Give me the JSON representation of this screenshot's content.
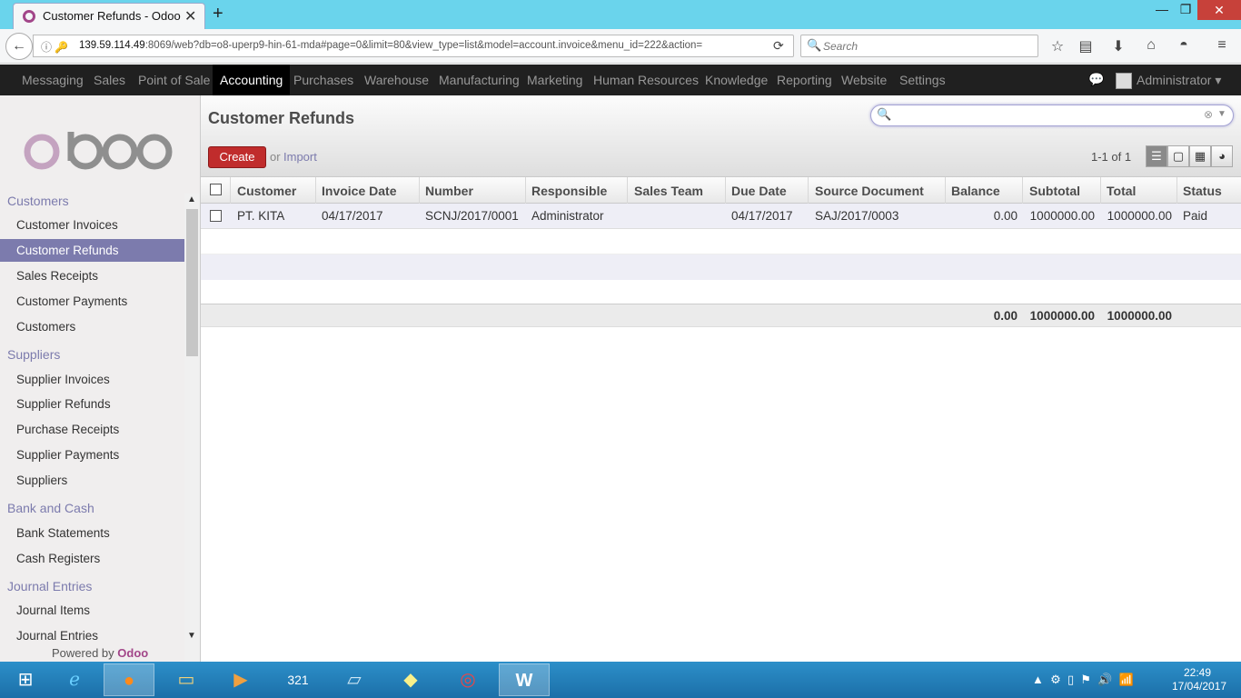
{
  "browser": {
    "tab_title": "Customer Refunds - Odoo",
    "url_host": "139.59.114.49",
    "url_rest": ":8069/web?db=o8-uperp9-hin-61-mda#page=0&limit=80&view_type=list&model=account.invoice&menu_id=222&action=",
    "search_placeholder": "Search",
    "new_tab": "+"
  },
  "menu": {
    "items": [
      "Messaging",
      "Sales",
      "Point of Sale",
      "Accounting",
      "Purchases",
      "Warehouse",
      "Manufacturing",
      "Marketing",
      "Human Resources",
      "Knowledge",
      "Reporting",
      "Website",
      "Settings"
    ],
    "active": "Accounting",
    "user": "Administrator"
  },
  "sidebar": {
    "logo": "odoo",
    "sections": [
      {
        "title": "Customers",
        "items": [
          "Customer Invoices",
          "Customer Refunds",
          "Sales Receipts",
          "Customer Payments",
          "Customers"
        ]
      },
      {
        "title": "Suppliers",
        "items": [
          "Supplier Invoices",
          "Supplier Refunds",
          "Purchase Receipts",
          "Supplier Payments",
          "Suppliers"
        ]
      },
      {
        "title": "Bank and Cash",
        "items": [
          "Bank Statements",
          "Cash Registers"
        ]
      },
      {
        "title": "Journal Entries",
        "items": [
          "Journal Items",
          "Journal Entries"
        ]
      }
    ],
    "active_item": "Customer Refunds",
    "powered_by": "Powered by",
    "powered_brand": "Odoo"
  },
  "main": {
    "title": "Customer Refunds",
    "create_label": "Create",
    "or_label": "or",
    "import_label": "Import",
    "pager": "1-1 of 1",
    "search_value": "",
    "columns": [
      "Customer",
      "Invoice Date",
      "Number",
      "Responsible",
      "Sales Team",
      "Due Date",
      "Source Document",
      "Balance",
      "Subtotal",
      "Total",
      "Status"
    ],
    "rows": [
      {
        "customer": "PT. KITA",
        "invoice_date": "04/17/2017",
        "number": "SCNJ/2017/0001",
        "responsible": "Administrator",
        "sales_team": "",
        "due_date": "04/17/2017",
        "source_document": "SAJ/2017/0003",
        "balance": "0.00",
        "subtotal": "1000000.00",
        "total": "1000000.00",
        "status": "Paid"
      }
    ],
    "totals": {
      "balance": "0.00",
      "subtotal": "1000000.00",
      "total": "1000000.00"
    }
  },
  "taskbar": {
    "clock_time": "22:49",
    "clock_date": "17/04/2017",
    "apps": [
      "start-icon",
      "ie-icon",
      "firefox-icon",
      "explorer-icon",
      "media-player-icon",
      "calendar-321-icon",
      "notepad-icon",
      "sticky-notes-icon",
      "chrome-icon",
      "word-icon"
    ]
  }
}
